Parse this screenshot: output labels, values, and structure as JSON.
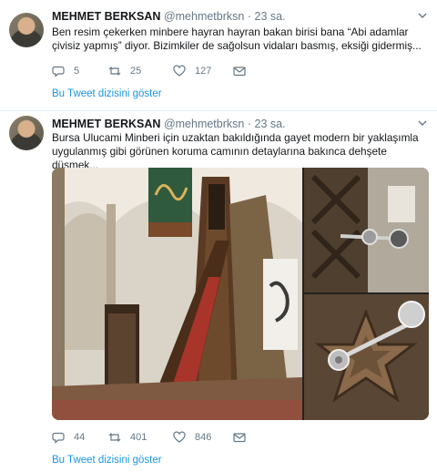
{
  "tweets": [
    {
      "name": "MEHMET BERKSAN",
      "handle": "@mehmetbrksn",
      "dot": "·",
      "time": "23 sa.",
      "text": "Ben resim çekerken minbere hayran hayran bakan birisi bana “Abi adamlar çivisiz yapmış” diyor. Bizimkiler de sağolsun vidaları basmış, eksiği gidermiş...",
      "replies": "5",
      "retweets": "25",
      "likes": "127",
      "thread_link": "Bu Tweet dizisini göster"
    },
    {
      "name": "MEHMET BERKSAN",
      "handle": "@mehmetbrksn",
      "dot": "·",
      "time": "23 sa.",
      "text": "Bursa Ulucami Minberi için uzaktan bakıldığında gayet modern bir yaklaşımla uygulanmış gibi görünen koruma camının detaylarına bakınca dehşete düşmek...",
      "replies": "44",
      "retweets": "401",
      "likes": "846",
      "thread_link": "Bu Tweet dizisini göster"
    }
  ],
  "icons": {
    "reply": "reply-icon",
    "retweet": "retweet-icon",
    "like": "heart-icon",
    "message": "envelope-icon",
    "more": "chevron-down-icon"
  },
  "colors": {
    "link": "#1b95e0",
    "muted": "#657786",
    "text": "#14171a",
    "divider": "#e6ecf0"
  }
}
